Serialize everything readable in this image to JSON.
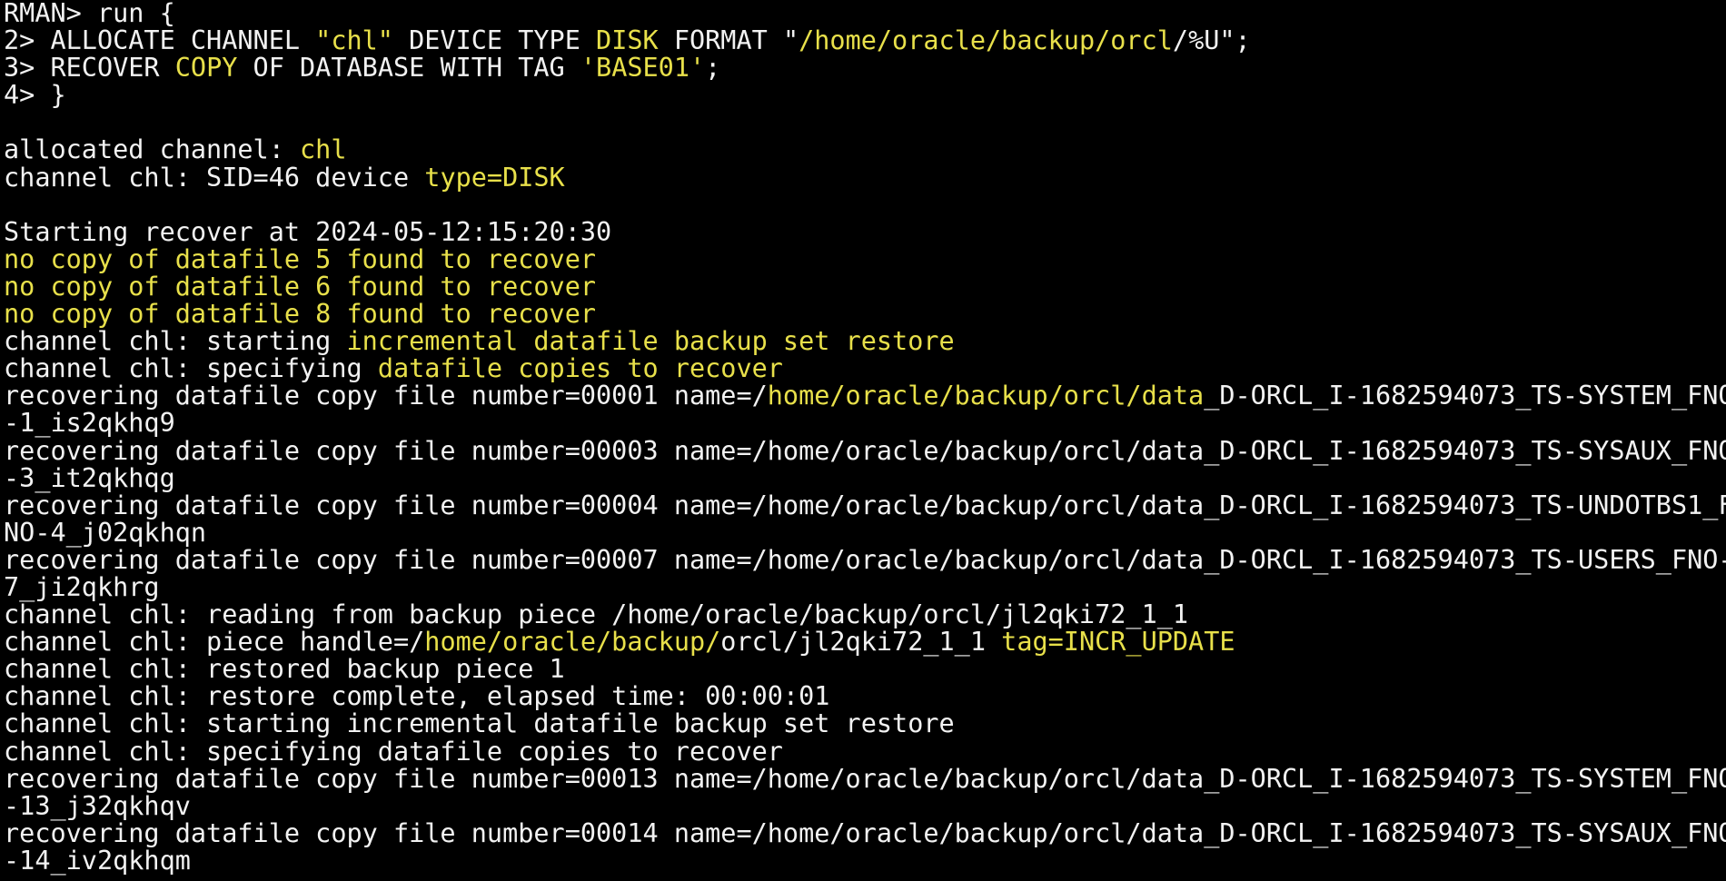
{
  "terminal": {
    "colors": {
      "background": "#000000",
      "text": "#f2f2f2",
      "highlight": "#e8e04a"
    },
    "lines": [
      [
        {
          "t": "RMAN> run {",
          "c": "w"
        }
      ],
      [
        {
          "t": "2> ALLOCATE CHANNEL ",
          "c": "w"
        },
        {
          "t": "\"chl\"",
          "c": "y"
        },
        {
          "t": " DEVICE TYPE ",
          "c": "w"
        },
        {
          "t": "DISK",
          "c": "y"
        },
        {
          "t": " FORMAT \"",
          "c": "w"
        },
        {
          "t": "/home/oracle/backup/orcl",
          "c": "y"
        },
        {
          "t": "/%U\";",
          "c": "w"
        }
      ],
      [
        {
          "t": "3> RECOVER ",
          "c": "w"
        },
        {
          "t": "COPY",
          "c": "y"
        },
        {
          "t": " OF DATABASE WITH TAG ",
          "c": "w"
        },
        {
          "t": "'BASE01'",
          "c": "y"
        },
        {
          "t": ";",
          "c": "w"
        }
      ],
      [
        {
          "t": "4> }",
          "c": "w"
        }
      ],
      [
        {
          "t": "",
          "c": "w"
        }
      ],
      [
        {
          "t": "allocated channel: ",
          "c": "w"
        },
        {
          "t": "chl",
          "c": "y"
        }
      ],
      [
        {
          "t": "channel chl: SID=46 device ",
          "c": "w"
        },
        {
          "t": "type=DISK",
          "c": "y"
        }
      ],
      [
        {
          "t": "",
          "c": "w"
        }
      ],
      [
        {
          "t": "Starting recover at 2024-05-12:15:20:30",
          "c": "w"
        }
      ],
      [
        {
          "t": "no copy of datafile 5 found to recover",
          "c": "y"
        }
      ],
      [
        {
          "t": "no copy of datafile 6 found to recover",
          "c": "y"
        }
      ],
      [
        {
          "t": "no copy of datafile 8 found to recover",
          "c": "y"
        }
      ],
      [
        {
          "t": "channel chl: starting ",
          "c": "w"
        },
        {
          "t": "incremental datafile backup set restore",
          "c": "y"
        }
      ],
      [
        {
          "t": "channel chl: specifying ",
          "c": "w"
        },
        {
          "t": "datafile copies to recover",
          "c": "y"
        }
      ],
      [
        {
          "t": "recovering datafile copy file number=00001 name=/",
          "c": "w"
        },
        {
          "t": "home/oracle/backup/orcl/data",
          "c": "y"
        },
        {
          "t": "_D-ORCL_I-1682594073_TS-SYSTEM_FNO",
          "c": "w"
        }
      ],
      [
        {
          "t": "-1_is2qkhq9",
          "c": "w"
        }
      ],
      [
        {
          "t": "recovering datafile copy file number=00003 name=/home/oracle/backup/orcl/data_D-ORCL_I-1682594073_TS-SYSAUX_FNO",
          "c": "w"
        }
      ],
      [
        {
          "t": "-3_it2qkhqg",
          "c": "w"
        }
      ],
      [
        {
          "t": "recovering datafile copy file number=00004 name=/home/oracle/backup/orcl/data_D-ORCL_I-1682594073_TS-UNDOTBS1_F",
          "c": "w"
        }
      ],
      [
        {
          "t": "NO-4_j02qkhqn",
          "c": "w"
        }
      ],
      [
        {
          "t": "recovering datafile copy file number=00007 name=/home/oracle/backup/orcl/data_D-ORCL_I-1682594073_TS-USERS_FNO-",
          "c": "w"
        }
      ],
      [
        {
          "t": "7_ji2qkhrg",
          "c": "w"
        }
      ],
      [
        {
          "t": "channel chl: reading from backup piece /home/oracle/backup/orcl/jl2qki72_1_1",
          "c": "w"
        }
      ],
      [
        {
          "t": "channel chl: piece handle=/",
          "c": "w"
        },
        {
          "t": "home/oracle/backup/",
          "c": "y"
        },
        {
          "t": "orcl/jl2qki72_1_1 ",
          "c": "w"
        },
        {
          "t": "tag=INCR_UPDATE",
          "c": "y"
        }
      ],
      [
        {
          "t": "channel chl: restored backup piece 1",
          "c": "w"
        }
      ],
      [
        {
          "t": "channel chl: restore complete, elapsed time: 00:00:01",
          "c": "w"
        }
      ],
      [
        {
          "t": "channel chl: starting incremental datafile backup set restore",
          "c": "w"
        }
      ],
      [
        {
          "t": "channel chl: specifying datafile copies to recover",
          "c": "w"
        }
      ],
      [
        {
          "t": "recovering datafile copy file number=00013 name=/home/oracle/backup/orcl/data_D-ORCL_I-1682594073_TS-SYSTEM_FNO",
          "c": "w"
        }
      ],
      [
        {
          "t": "-13_j32qkhqv",
          "c": "w"
        }
      ],
      [
        {
          "t": "recovering datafile copy file number=00014 name=/home/oracle/backup/orcl/data_D-ORCL_I-1682594073_TS-SYSAUX_FNO",
          "c": "w"
        }
      ],
      [
        {
          "t": "-14_iv2qkhqm",
          "c": "w"
        }
      ]
    ]
  }
}
